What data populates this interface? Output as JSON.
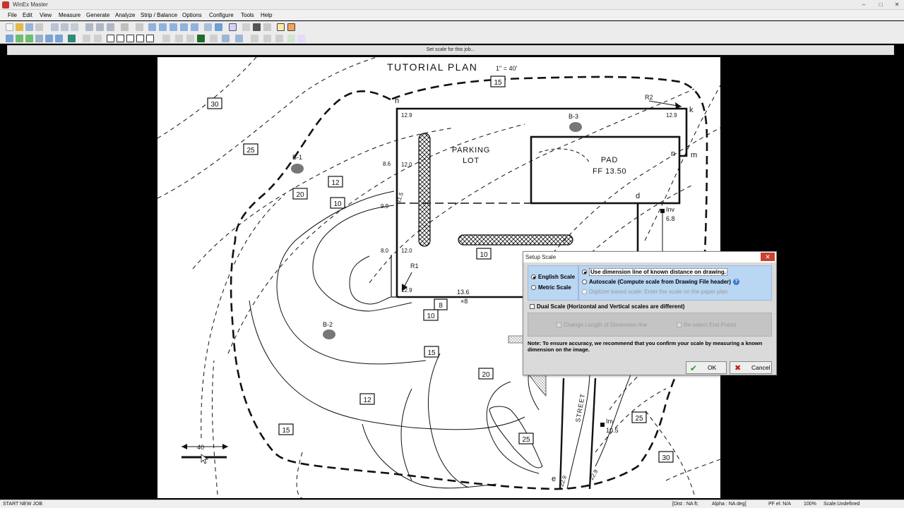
{
  "window": {
    "title": "WinEx Master",
    "controls": [
      "–",
      "□",
      "✕"
    ]
  },
  "menu": [
    "File",
    "Edit",
    "View",
    "Measure",
    "Generate",
    "Analyze",
    "Strip / Balance",
    "Options",
    "Configure",
    "Tools",
    "Help"
  ],
  "status_strip": {
    "text": "Set scale for this job..."
  },
  "drawing": {
    "title": "TUTORIAL PLAN",
    "scale_note": "1\" = 40'",
    "labels": {
      "parking_lot_1": "PARKING",
      "parking_lot_2": "LOT",
      "pad_1": "PAD",
      "pad_2": "FF 13.50",
      "street": "STREET",
      "b1": "B-1",
      "b2": "B-2",
      "b3": "B-3",
      "r1": "R1",
      "r2": "R2",
      "h": "h",
      "k": "k",
      "n": "n",
      "m": "m",
      "d": "d",
      "e": "e",
      "inv1_label": "Inv",
      "inv1_value": "6.8",
      "inv2_label": "Inv",
      "inv2_value": "10.5",
      "elev_12_9a": "12.9",
      "elev_12_9b": "12.9",
      "elev_8_6": "8.6",
      "elev_12_0a": "12.0",
      "elev_9_9": "9.9",
      "elev_11_5": "11.5",
      "elev_8_0": "8.0",
      "elev_12_0b": "12.0",
      "elev_12_9c": "12.9",
      "elev_13_6": "13.6",
      "elev_x8": "×8",
      "elev_22_9a": "22.9",
      "elev_22_9b": "22.9",
      "scale_bar": "40"
    },
    "contour_tags": [
      "30",
      "25",
      "20",
      "12",
      "10",
      "15",
      "10",
      "8",
      "10",
      "15",
      "20",
      "12",
      "15",
      "25",
      "25",
      "30"
    ]
  },
  "dialog": {
    "title": "Setup Scale",
    "close": "✕",
    "english_scale": "English Scale",
    "metric_scale": "Metric Scale",
    "opt_dimension_line": "Use dimension line of known distance on drawing.",
    "opt_autoscale": "Autoscale (Compute scale from Drawing File header)",
    "opt_digitizer": "Digitizer based scale: Enter the scale on the paper plan.",
    "dual_scale": "Dual Scale  (Horizontal and Vertical scales are different)",
    "change_length": "Change Length of Dimension line",
    "reselect_end": "Re-select End Points",
    "note": "Note: To ensure accuracy, we recommend that you confirm your scale by measuring a known dimension on  the image.",
    "ok": "OK",
    "cancel": "Cancel"
  },
  "statusbar": {
    "left": "START NEW JOB",
    "dist": "[Dist :  NA   ft;",
    "alpha": "Alpha :  NA  deg]",
    "pf": "PF el: N/A",
    "zoom": "100%",
    "scale": "Scale:Undefined"
  }
}
